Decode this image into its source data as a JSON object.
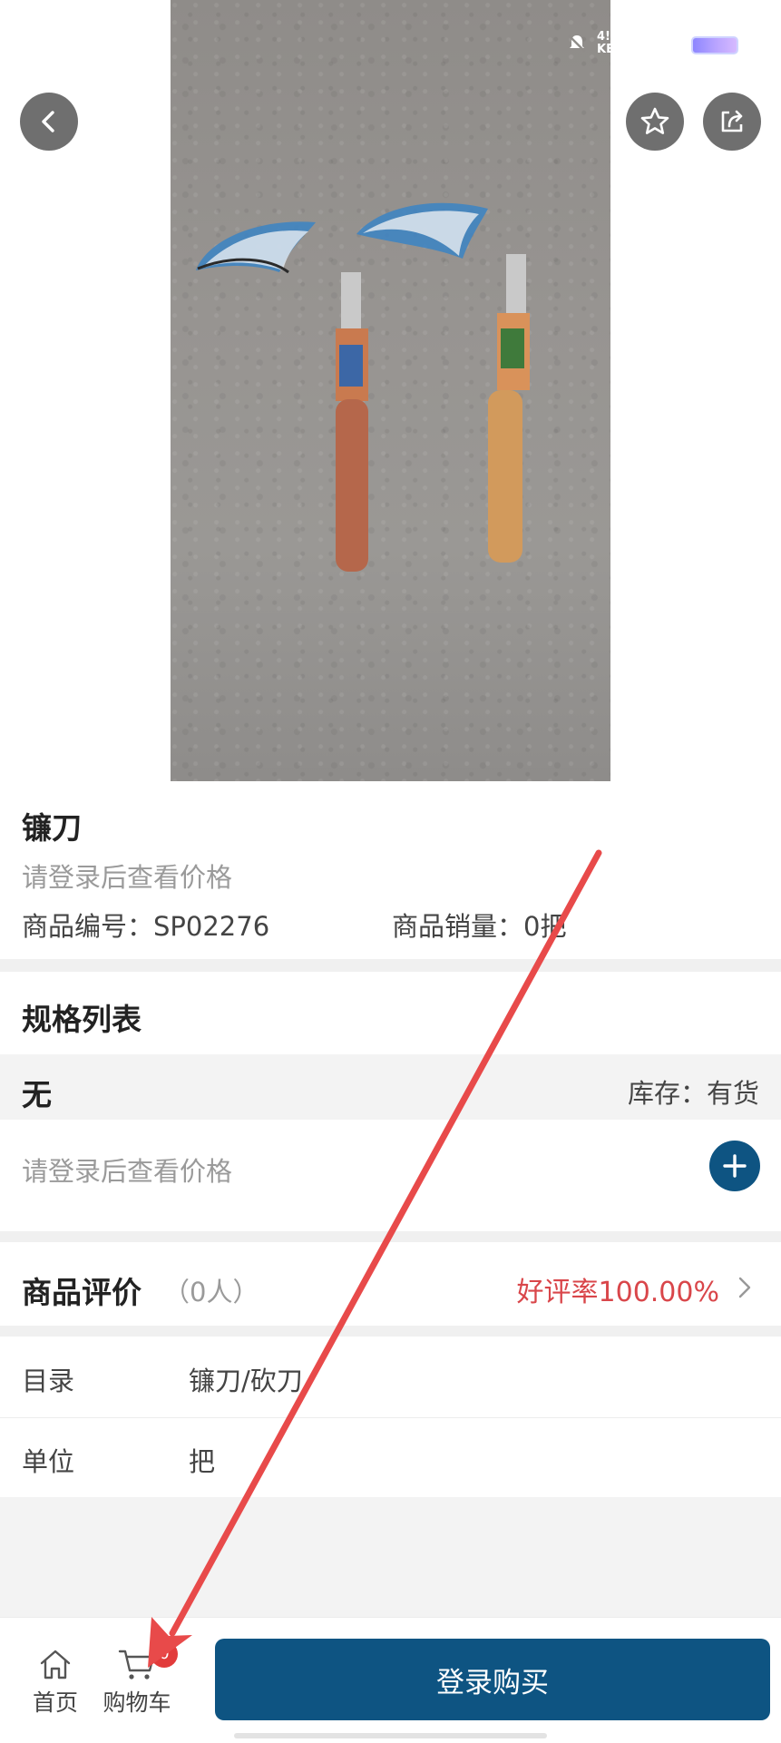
{
  "status": {
    "text": "4!\nKE"
  },
  "product": {
    "name": "镰刀",
    "price_hint": "请登录后查看价格",
    "sku_label": "商品编号：SP02276",
    "sales_label": "商品销量：0把"
  },
  "spec": {
    "section_title": "规格列表",
    "name": "无",
    "stock_label": "库存：有货",
    "price_hint": "请登录后查看价格"
  },
  "reviews": {
    "title": "商品评价",
    "count": "（0人）",
    "rate": "好评率100.00%"
  },
  "attributes": [
    {
      "key": "目录",
      "value": "镰刀/砍刀"
    },
    {
      "key": "单位",
      "value": "把"
    }
  ],
  "bottom_nav": {
    "home_label": "首页",
    "cart_label": "购物车",
    "cart_count": "0",
    "buy_label": "登录购买"
  },
  "colors": {
    "primary": "#0e5482",
    "rate_red": "#d9464a",
    "badge_red": "#e23b3b",
    "annotation_red": "#e84a4a"
  },
  "icons": [
    "back-icon",
    "star-icon",
    "share-icon",
    "plus-icon",
    "chevron-right-icon",
    "home-icon",
    "cart-icon",
    "mute-icon",
    "battery-icon"
  ]
}
